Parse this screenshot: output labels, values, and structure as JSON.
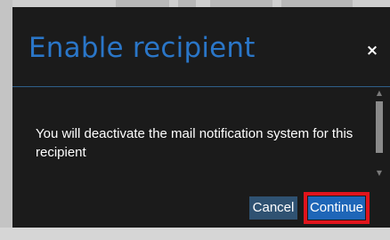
{
  "dialog": {
    "title": "Enable recipient",
    "close_glyph": "×",
    "message": "You will deactivate the mail notification system for this recipient",
    "cancel_label": "Cancel",
    "continue_label": "Continue"
  },
  "colors": {
    "modal_background": "#1b1b1b",
    "title": "#2a76c8",
    "header_divider": "#2f5f8a",
    "cancel_button": "#2f5272",
    "continue_button": "#1e66b8",
    "highlight": "#e1141c"
  },
  "icons": {
    "close": "close-icon",
    "scroll_up": "chevron-up-icon",
    "scroll_down": "chevron-down-icon"
  }
}
